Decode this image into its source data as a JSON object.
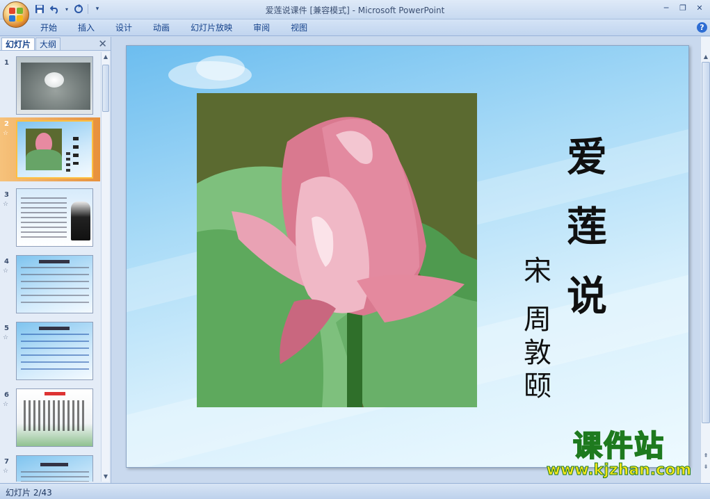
{
  "window": {
    "title": "爱莲说课件 [兼容模式] - Microsoft PowerPoint"
  },
  "quick_access": [
    "save-icon",
    "undo-icon",
    "redo-icon",
    "customize-icon"
  ],
  "ribbon": {
    "tabs": [
      "开始",
      "插入",
      "设计",
      "动画",
      "幻灯片放映",
      "审阅",
      "视图"
    ]
  },
  "left_panel": {
    "tabs": [
      "幻灯片",
      "大纲"
    ],
    "active_tab": "幻灯片",
    "thumbnails": [
      {
        "num": "1"
      },
      {
        "num": "2",
        "selected": true
      },
      {
        "num": "3"
      },
      {
        "num": "4"
      },
      {
        "num": "5"
      },
      {
        "num": "6"
      },
      {
        "num": "7"
      }
    ]
  },
  "slide": {
    "title_chars": [
      "爱",
      "莲",
      "说"
    ],
    "author_chars": [
      "宋",
      "周",
      "敦",
      "颐"
    ]
  },
  "watermark": {
    "main": "课件站",
    "url": "www.kjzhan.com"
  },
  "statusbar": {
    "slide_indicator": "幻灯片 2/43"
  },
  "colors": {
    "ribbon_text": "#15428b",
    "selected_thumb": "#e7903c",
    "watermark_fill": "#f5e61a",
    "watermark_stroke": "#1e7a1e"
  }
}
